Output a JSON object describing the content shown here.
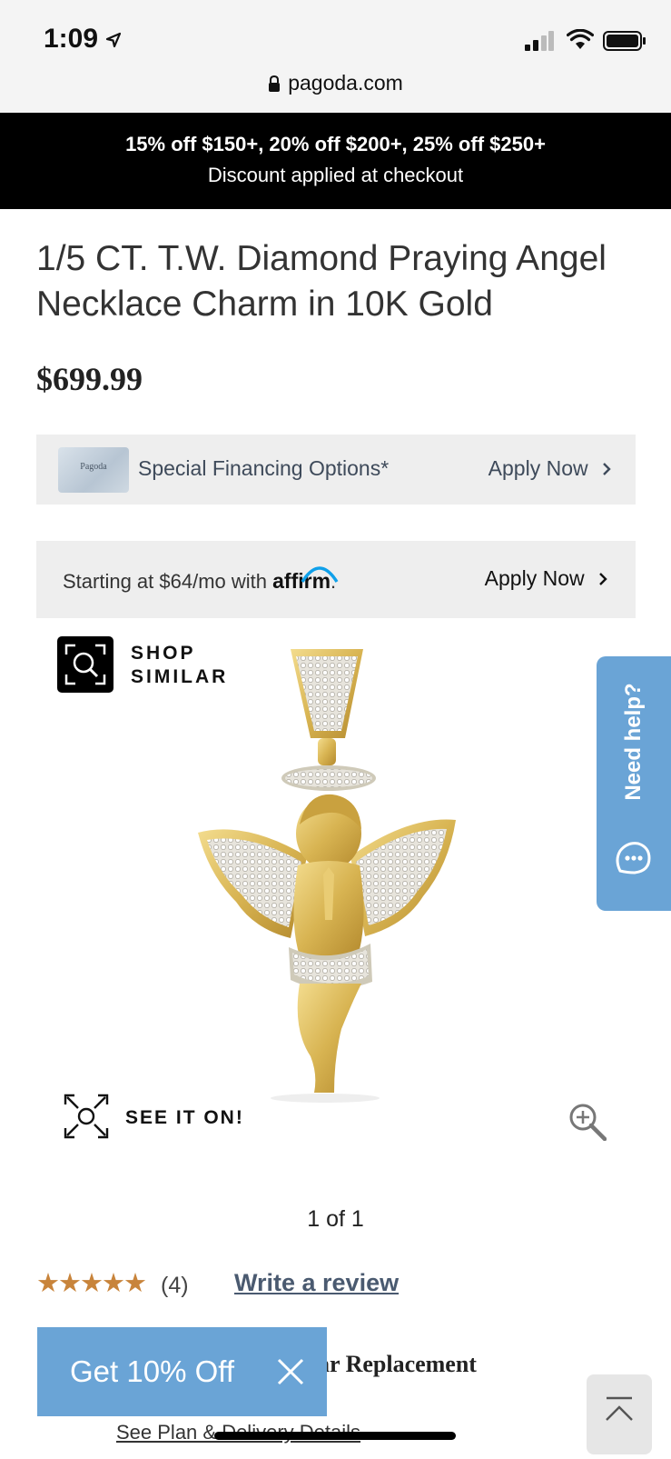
{
  "status_bar": {
    "time": "1:09",
    "url": "pagoda.com"
  },
  "promo": {
    "line1": "15% off $150+, 20% off $200+, 25% off $250+",
    "line2": "Discount applied at checkout"
  },
  "product": {
    "title": "1/5 CT. T.W. Diamond Praying Angel Necklace Charm in 10K Gold",
    "price": "$699.99"
  },
  "financing": {
    "card_text": "Pagoda",
    "label": "Special Financing Options*",
    "apply_label": "Apply Now"
  },
  "affirm": {
    "label": "Starting at $64/mo with",
    "logo": "affirm",
    "logo_suffix": ".",
    "apply_label": "Apply Now"
  },
  "shop_similar": {
    "line1": "SHOP",
    "line2": "SIMILAR"
  },
  "help": {
    "label": "Need help?"
  },
  "see_it_on": {
    "label": "SEE IT ON!"
  },
  "gallery": {
    "pager": "1 of 1"
  },
  "reviews": {
    "stars": "★★★★★",
    "rating": 5,
    "count": "(4)",
    "write_label": "Write a review"
  },
  "replacement": {
    "label": "ar Replacement",
    "see_plan": "See Plan & Delivery Details"
  },
  "discount_popup": {
    "label": "Get 10% Off"
  },
  "colors": {
    "accent": "#6aa4d6",
    "star": "#c8843b",
    "promo_bg": "#000000"
  }
}
